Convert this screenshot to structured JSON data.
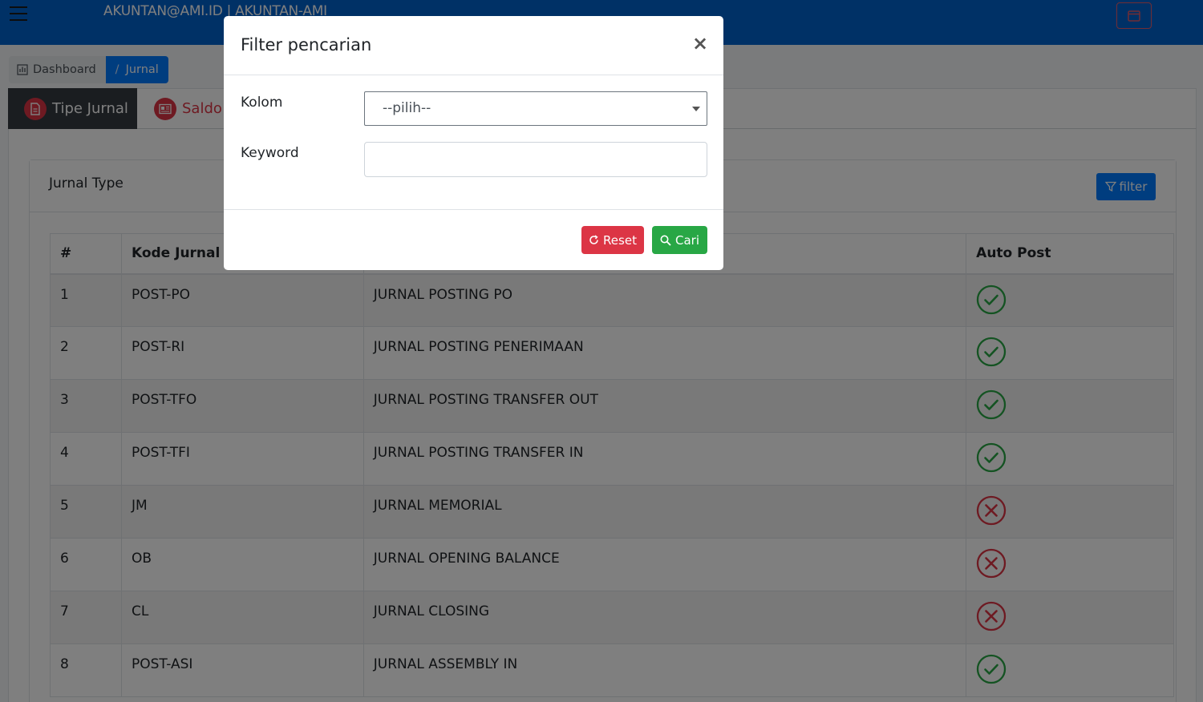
{
  "navbar": {
    "account": "AKUNTAN@AMI.ID | AKUNTAN-AMI"
  },
  "breadcrumb": {
    "dashboard": "Dashboard",
    "jurnal": "Jurnal"
  },
  "tabs": {
    "tipe_jurnal": "Tipe Jurnal",
    "saldo": "Saldo A"
  },
  "card": {
    "title": "Jurnal Type",
    "filter_label": "filter"
  },
  "table": {
    "headers": [
      "#",
      "Kode Jurnal",
      "",
      "Auto Post"
    ],
    "rows": [
      {
        "no": "1",
        "kode": "POST-PO",
        "nama": "JURNAL POSTING PO",
        "auto": true
      },
      {
        "no": "2",
        "kode": "POST-RI",
        "nama": "JURNAL POSTING PENERIMAAN",
        "auto": true
      },
      {
        "no": "3",
        "kode": "POST-TFO",
        "nama": "JURNAL POSTING TRANSFER OUT",
        "auto": true
      },
      {
        "no": "4",
        "kode": "POST-TFI",
        "nama": "JURNAL POSTING TRANSFER IN",
        "auto": true
      },
      {
        "no": "5",
        "kode": "JM",
        "nama": "JURNAL MEMORIAL",
        "auto": false
      },
      {
        "no": "6",
        "kode": "OB",
        "nama": "JURNAL OPENING BALANCE",
        "auto": false
      },
      {
        "no": "7",
        "kode": "CL",
        "nama": "JURNAL CLOSING",
        "auto": false
      },
      {
        "no": "8",
        "kode": "POST-ASI",
        "nama": "JURNAL ASSEMBLY IN",
        "auto": true
      }
    ]
  },
  "modal": {
    "title": "Filter pencarian",
    "close": "×",
    "kolom_label": "Kolom",
    "kolom_value": "--pilih--",
    "keyword_label": "Keyword",
    "keyword_value": "",
    "reset_label": "Reset",
    "cari_label": "Cari"
  },
  "colors": {
    "navbar": "#0062cc",
    "primary": "#007bff",
    "danger": "#dc3545",
    "success": "#28a745",
    "dark": "#343a40"
  }
}
